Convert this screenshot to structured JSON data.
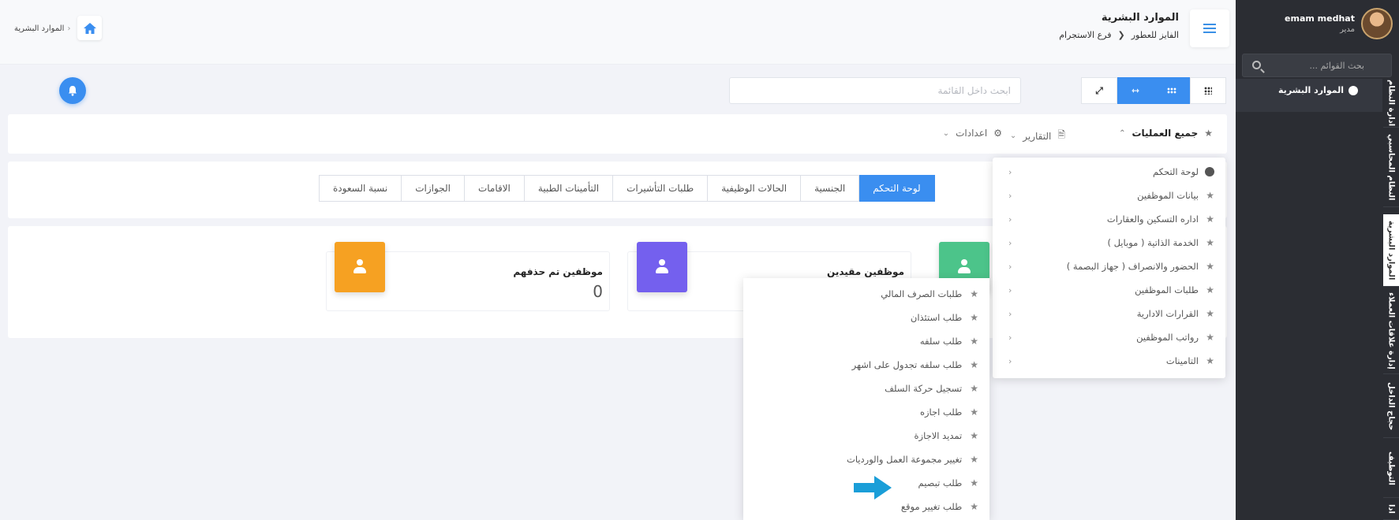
{
  "sidebar": {
    "user_name": "emam medhat",
    "user_role": "مدير",
    "search_placeholder": "بحث القوائم ...",
    "active_menu": "الموارد البشرية",
    "vertical_tabs": [
      "ادارة النظام",
      "النظام المحاسبي",
      "الموارد البشرية",
      "إدارة علاقات العملاء",
      "حجاج الداخل",
      "التوظيف",
      "ادا"
    ]
  },
  "header": {
    "title": "الموارد البشرية",
    "crumb_company": "الفايز للعطور",
    "crumb_branch": "فرع الاستجرام",
    "left_crumb": "الموارد البشرية"
  },
  "toolbar": {
    "search_placeholder": "ابحث داخل القائمة"
  },
  "ops": {
    "all_ops": "جميع العمليات",
    "reports": "التقارير",
    "settings": "اعدادات"
  },
  "tabs": [
    "لوحة التحكم",
    "الجنسية",
    "الحالات الوظيفية",
    "طلبات التأشيرات",
    "التأمينات الطبية",
    "الاقامات",
    "الجوازات",
    "نسبة السعودة"
  ],
  "stats": {
    "restricted_label": "موظفين مقيدين",
    "deleted_label": "موظفين تم حذفهم",
    "deleted_value": "0"
  },
  "dropdown": [
    "لوحة التحكم",
    "بيانات الموظفين",
    "اداره التسكين والعقارات",
    "الخدمة الذاتية ( موبايل )",
    "الحضور والانصراف ( جهاز البصمة )",
    "طلبات الموظفين",
    "القرارات الادارية",
    "رواتب الموظفين",
    "التامينات"
  ],
  "submenu": [
    "طلبات الصرف المالي",
    "طلب استئذان",
    "طلب سلفه",
    "طلب سلفه تجدول على اشهر",
    "تسجيل حركة السلف",
    "طلب اجازه",
    "تمديد الاجازة",
    "تغيير مجموعة العمل والورديات",
    "طلب تبصيم",
    "طلب تغيير موقع"
  ],
  "colors": {
    "primary": "#3a8ef0",
    "green": "#4cc48a",
    "purple": "#7460ee",
    "orange": "#f6a122",
    "sidebar": "#2b2d33",
    "arrow": "#1a9ed8"
  }
}
